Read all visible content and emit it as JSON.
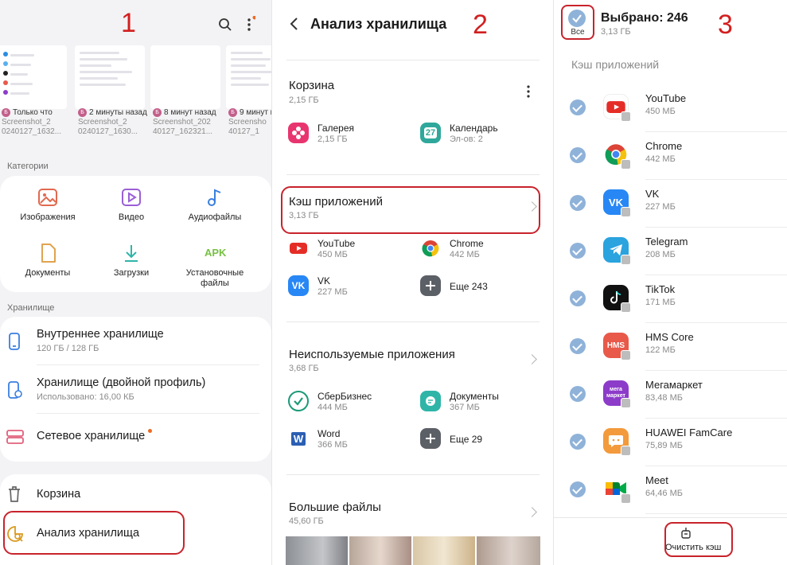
{
  "markers": {
    "one": "1",
    "two": "2",
    "three": "3"
  },
  "p1": {
    "thumbnails": [
      {
        "time": "Только что",
        "name": "Screenshot_2",
        "name2": "0240127_1632..."
      },
      {
        "time": "2 минуты назад",
        "name": "Screenshot_2",
        "name2": "0240127_1630..."
      },
      {
        "time": "8 минут назад",
        "name": "Screenshot_202",
        "name2": "40127_162321..."
      },
      {
        "time": "9 минут н",
        "name": "Screensho",
        "name2": "40127_1"
      }
    ],
    "categories_title": "Категории",
    "categories": [
      {
        "label": "Изображения",
        "icon": "image-icon",
        "color": "#e06a4f"
      },
      {
        "label": "Видео",
        "icon": "video-icon",
        "color": "#9b5fd6"
      },
      {
        "label": "Аудиофайлы",
        "icon": "music-note-icon",
        "color": "#3a7fe0"
      },
      {
        "label": "Документы",
        "icon": "document-icon",
        "color": "#e0a34f"
      },
      {
        "label": "Загрузки",
        "icon": "download-icon",
        "color": "#2fb5a8"
      },
      {
        "label": "Установочные файлы",
        "icon": "apk-icon",
        "color": "#76c043",
        "apk": "APK"
      }
    ],
    "storage_title": "Хранилище",
    "storage": [
      {
        "label": "Внутреннее хранилище",
        "sub": "120 ГБ / 128 ГБ"
      },
      {
        "label": "Хранилище (двойной профиль)",
        "sub": "Использовано: 16,00 КБ"
      },
      {
        "label": "Сетевое хранилище",
        "sub": ""
      }
    ],
    "trash": "Корзина",
    "analysis": "Анализ хранилища"
  },
  "p2": {
    "title": "Анализ хранилища",
    "trash": {
      "title": "Корзина",
      "size": "2,15 ГБ",
      "apps": [
        {
          "name": "Галерея",
          "size": "2,15 ГБ"
        },
        {
          "name": "Календарь",
          "size": "Эл-ов: 2",
          "day": "27"
        }
      ]
    },
    "cache": {
      "title": "Кэш приложений",
      "size": "3,13 ГБ",
      "apps": [
        {
          "name": "YouTube",
          "size": "450 МБ"
        },
        {
          "name": "Chrome",
          "size": "442 МБ"
        },
        {
          "name": "VK",
          "size": "227 МБ"
        },
        {
          "name": "Еще 243",
          "size": ""
        }
      ]
    },
    "unused": {
      "title": "Неиспользуемые приложения",
      "size": "3,68 ГБ",
      "apps": [
        {
          "name": "СберБизнес",
          "size": "444 МБ"
        },
        {
          "name": "Документы",
          "size": "367 МБ"
        },
        {
          "name": "Word",
          "size": "366 МБ"
        },
        {
          "name": "Еще 29",
          "size": ""
        }
      ]
    },
    "large": {
      "title": "Большие файлы",
      "size": "45,60 ГБ"
    }
  },
  "p3": {
    "all_label": "Все",
    "selected": "Выбрано: 246",
    "selected_size": "3,13 ГБ",
    "section": "Кэш приложений",
    "apps": [
      {
        "name": "YouTube",
        "size": "450 МБ",
        "color": "#ffffff"
      },
      {
        "name": "Chrome",
        "size": "442 МБ",
        "color": "#ffffff"
      },
      {
        "name": "VK",
        "size": "227 МБ",
        "color": "#2787f5"
      },
      {
        "name": "Telegram",
        "size": "208 МБ",
        "color": "#2aa3df"
      },
      {
        "name": "TikTok",
        "size": "171 МБ",
        "color": "#111111"
      },
      {
        "name": "HMS Core",
        "size": "122 МБ",
        "color": "#e8594a",
        "glyph": "HMS"
      },
      {
        "name": "Мегамаркет",
        "size": "83,48 МБ",
        "color": "#8c3cc9",
        "glyph": "мега маркет"
      },
      {
        "name": "HUAWEI FamCare",
        "size": "75,89 МБ",
        "color": "#f39a3c"
      },
      {
        "name": "Meet",
        "size": "64,46 МБ",
        "color": "#ffffff"
      }
    ],
    "clear_button": "Очистить кэш"
  }
}
